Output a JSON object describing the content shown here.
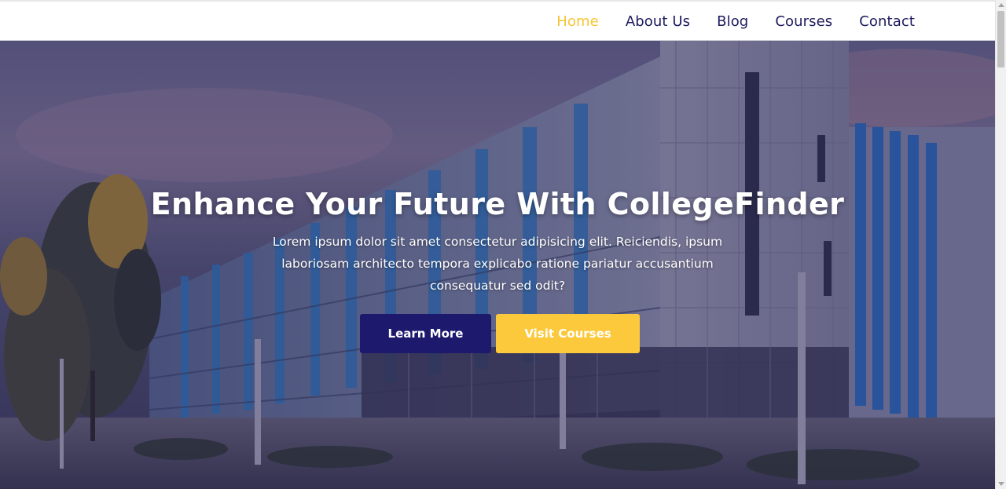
{
  "nav": {
    "items": [
      {
        "label": "Home",
        "active": true
      },
      {
        "label": "About Us",
        "active": false
      },
      {
        "label": "Blog",
        "active": false
      },
      {
        "label": "Courses",
        "active": false
      },
      {
        "label": "Contact",
        "active": false
      }
    ]
  },
  "hero": {
    "title": "Enhance Your Future With CollegeFinder",
    "text": "Lorem ipsum dolor sit amet consectetur adipisicing elit. Reiciendis, ipsum laboriosam architecto tempora explicabo ratione pariatur accusantium consequatur sed odit?",
    "primary_button": "Learn More",
    "secondary_button": "Visit Courses",
    "background": "college-building-photo"
  },
  "colors": {
    "accent": "#f7c634",
    "brand": "#1d1a6e",
    "nav_text": "#1c1a5e"
  }
}
